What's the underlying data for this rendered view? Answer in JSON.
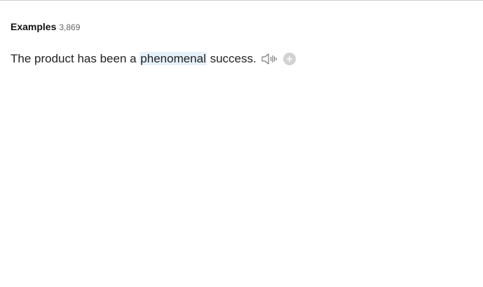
{
  "examples": {
    "title": "Examples",
    "count": "3,869",
    "items": [
      {
        "before": "The product has been a ",
        "highlight": "phenomenal",
        "after": " success."
      }
    ]
  },
  "icons": {
    "speaker": "speaker-icon",
    "add": "plus-circle-icon"
  },
  "colors": {
    "highlight": "#e6f1fb",
    "add_button": "#d2d2d2",
    "icon_stroke": "#7a7a7a"
  }
}
